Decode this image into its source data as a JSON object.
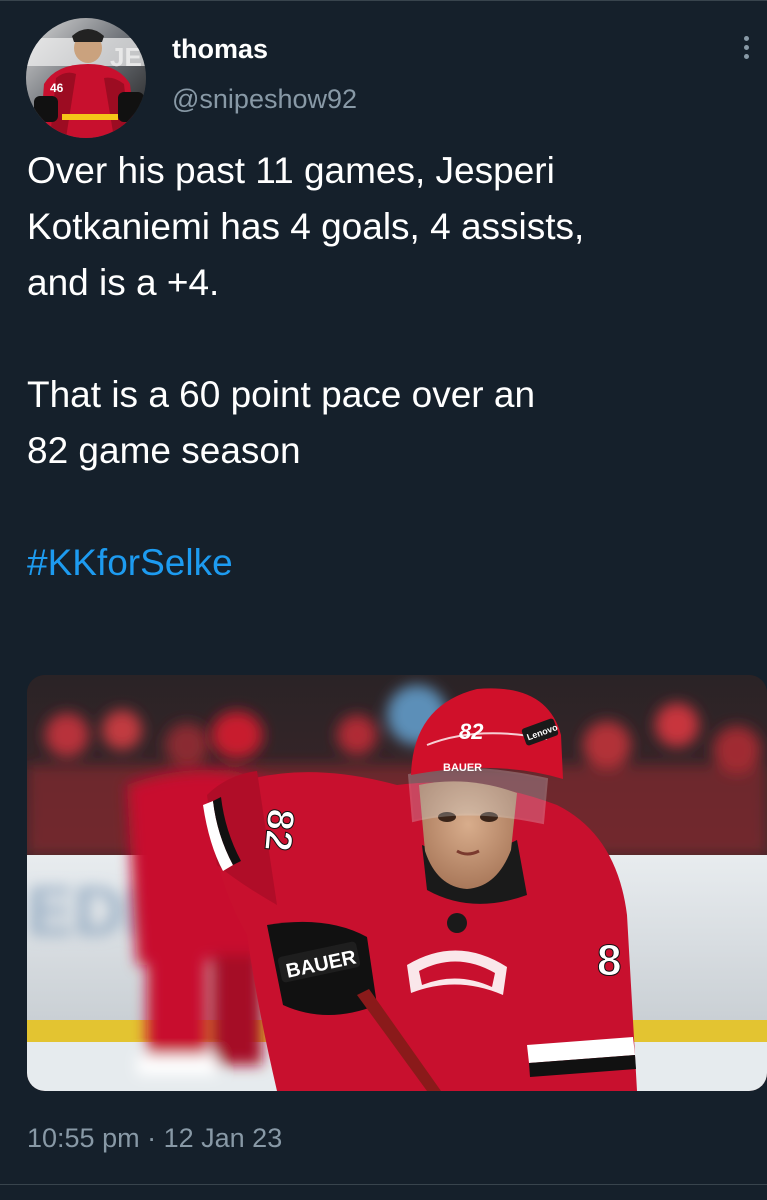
{
  "user": {
    "display_name": "thomas",
    "handle": "@snipeshow92"
  },
  "tweet": {
    "line1": "Over his past 11 games, Jesperi",
    "line2": "Kotkaniemi has 4 goals, 4 assists,",
    "line3": "and is a +4.",
    "line4": "That is a 60 point pace over an",
    "line5": "82 game season",
    "hashtag": "#KKforSelke"
  },
  "media": {
    "jersey_number": "82",
    "helmet_number": "82",
    "helmet_brand": "BAUER",
    "glove_brand": "BAUER",
    "helmet_sponsor": "Lenovo",
    "sleeve_number": "8"
  },
  "avatar": {
    "jersey_number": "46"
  },
  "meta": {
    "time": "10:55 pm",
    "separator": "·",
    "date": "12 Jan 23"
  },
  "colors": {
    "background": "#15202b",
    "text_primary": "#ffffff",
    "text_secondary": "#8899a6",
    "link": "#1d9bf0",
    "divider": "#38444d"
  }
}
